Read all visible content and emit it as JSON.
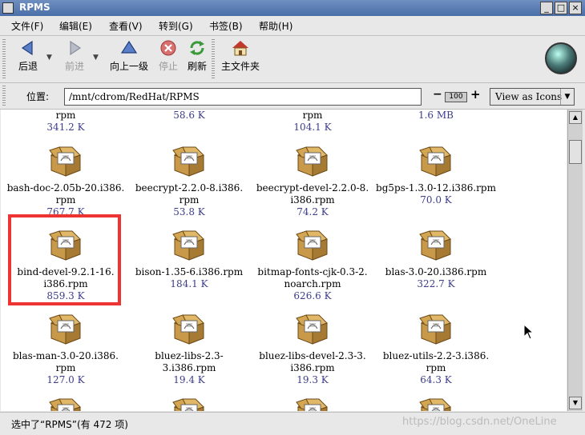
{
  "window": {
    "title": "RPMS"
  },
  "menu": [
    "文件(F)",
    "编辑(E)",
    "查看(V)",
    "转到(G)",
    "书签(B)",
    "帮助(H)"
  ],
  "toolbar": {
    "back": "后退",
    "forward": "前进",
    "up": "向上一级",
    "stop": "停止",
    "refresh": "刷新",
    "home": "主文件夹"
  },
  "location": {
    "label": "位置:",
    "value": "/mnt/cdrom/RedHat/RPMS",
    "zoom": "100",
    "view_as": "View as Icons"
  },
  "files": [
    {
      "name": "rpm",
      "size": "341.2 K"
    },
    {
      "name": "",
      "size": "58.6 K"
    },
    {
      "name": "rpm",
      "size": "104.1 K"
    },
    {
      "name": "",
      "size": "1.6 MB"
    },
    {
      "name": "bash-doc-2.05b-20.i386.rpm",
      "size": "767.7 K"
    },
    {
      "name": "beecrypt-2.2.0-8.i386.rpm",
      "size": "53.8 K"
    },
    {
      "name": "beecrypt-devel-2.2.0-8.i386.rpm",
      "size": "74.2 K"
    },
    {
      "name": "bg5ps-1.3.0-12.i386.rpm",
      "size": "70.0 K"
    },
    {
      "name": "bind-devel-9.2.1-16.i386.rpm",
      "size": "859.3 K"
    },
    {
      "name": "bison-1.35-6.i386.rpm",
      "size": "184.1 K"
    },
    {
      "name": "bitmap-fonts-cjk-0.3-2.noarch.rpm",
      "size": "626.6 K"
    },
    {
      "name": "blas-3.0-20.i386.rpm",
      "size": "322.7 K"
    },
    {
      "name": "blas-man-3.0-20.i386.rpm",
      "size": "127.0 K"
    },
    {
      "name": "bluez-libs-2.3-3.i386.rpm",
      "size": "19.4 K"
    },
    {
      "name": "bluez-libs-devel-2.3-3.i386.rpm",
      "size": "19.3 K"
    },
    {
      "name": "bluez-utils-2.2-3.i386.rpm",
      "size": "64.3 K"
    }
  ],
  "display_lines": {
    "f4": [
      "bash-doc-2.05b-20.i386.",
      "rpm"
    ],
    "f5": [
      "beecrypt-2.2.0-8.i386.",
      "rpm"
    ],
    "f6": [
      "beecrypt-devel-2.2.0-8.",
      "i386.rpm"
    ],
    "f7": [
      "bg5ps-1.3.0-12.i386.rpm"
    ],
    "f8": [
      "bind-devel-9.2.1-16.",
      "i386.rpm"
    ],
    "f9": [
      "bison-1.35-6.i386.rpm"
    ],
    "f10": [
      "bitmap-fonts-cjk-0.3-2.",
      "noarch.rpm"
    ],
    "f11": [
      "blas-3.0-20.i386.rpm"
    ],
    "f12": [
      "blas-man-3.0-20.i386.",
      "rpm"
    ],
    "f13": [
      "bluez-libs-2.3-3.i386.rpm"
    ],
    "f14": [
      "bluez-libs-devel-2.3-3.",
      "i386.rpm"
    ],
    "f15": [
      "bluez-utils-2.2-3.i386.",
      "rpm"
    ]
  },
  "status": {
    "text": "选中了“RPMS”(有 472 项)",
    "watermark": "https://blog.csdn.net/OneLine"
  }
}
